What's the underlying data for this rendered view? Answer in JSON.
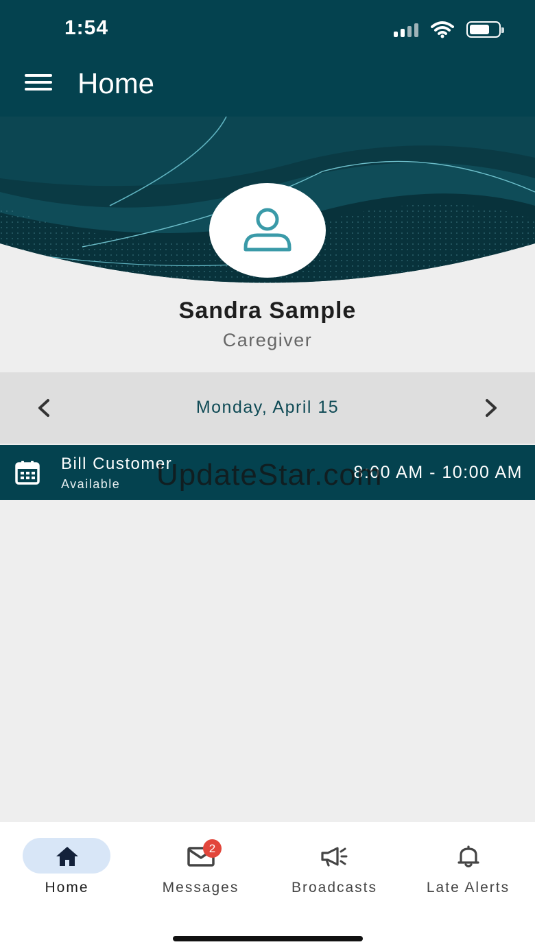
{
  "status_bar": {
    "time": "1:54"
  },
  "app_bar": {
    "title": "Home"
  },
  "profile": {
    "name": "Sandra Sample",
    "role": "Caregiver"
  },
  "date_nav": {
    "label": "Monday, April 15"
  },
  "appointments": [
    {
      "client": "Bill Customer",
      "status": "Available",
      "time": "8:00 AM - 10:00 AM"
    }
  ],
  "watermark": "UpdateStar.com",
  "bottom_nav": {
    "items": [
      {
        "label": "Home",
        "icon": "home-icon",
        "active": true
      },
      {
        "label": "Messages",
        "icon": "mail-icon",
        "badge": "2"
      },
      {
        "label": "Broadcasts",
        "icon": "megaphone-icon"
      },
      {
        "label": "Late Alerts",
        "icon": "bell-icon"
      }
    ]
  },
  "colors": {
    "primary": "#04424f",
    "accent": "#3a9aa8",
    "badge": "#e2463b",
    "nav_active_pill": "#d8e6f7",
    "background": "#eeeeee"
  }
}
